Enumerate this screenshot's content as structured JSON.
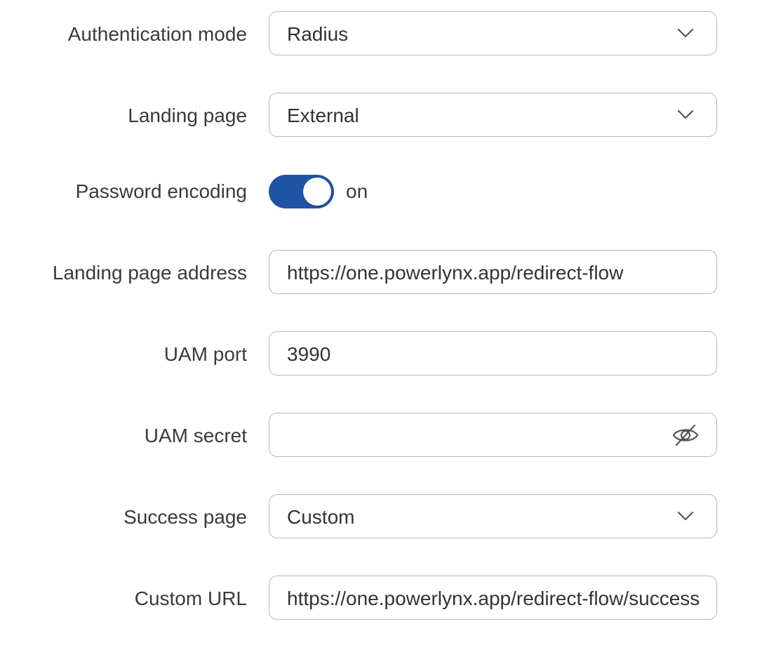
{
  "form": {
    "auth_mode": {
      "label": "Authentication mode",
      "value": "Radius"
    },
    "landing_page": {
      "label": "Landing page",
      "value": "External"
    },
    "password_encoding": {
      "label": "Password encoding",
      "state_text": "on",
      "enabled": true
    },
    "landing_page_address": {
      "label": "Landing page address",
      "value": "https://one.powerlynx.app/redirect-flow"
    },
    "uam_port": {
      "label": "UAM port",
      "value": "3990"
    },
    "uam_secret": {
      "label": "UAM secret",
      "value": ""
    },
    "success_page": {
      "label": "Success page",
      "value": "Custom"
    },
    "custom_url": {
      "label": "Custom URL",
      "value": "https://one.powerlynx.app/redirect-flow/success"
    }
  },
  "icons": {
    "dropdown": "chevron-down-icon",
    "secret_visibility": "eye-off-icon"
  },
  "colors": {
    "toggle_on": "#1f53a3",
    "border": "#b9b9b9",
    "text": "#333333"
  }
}
